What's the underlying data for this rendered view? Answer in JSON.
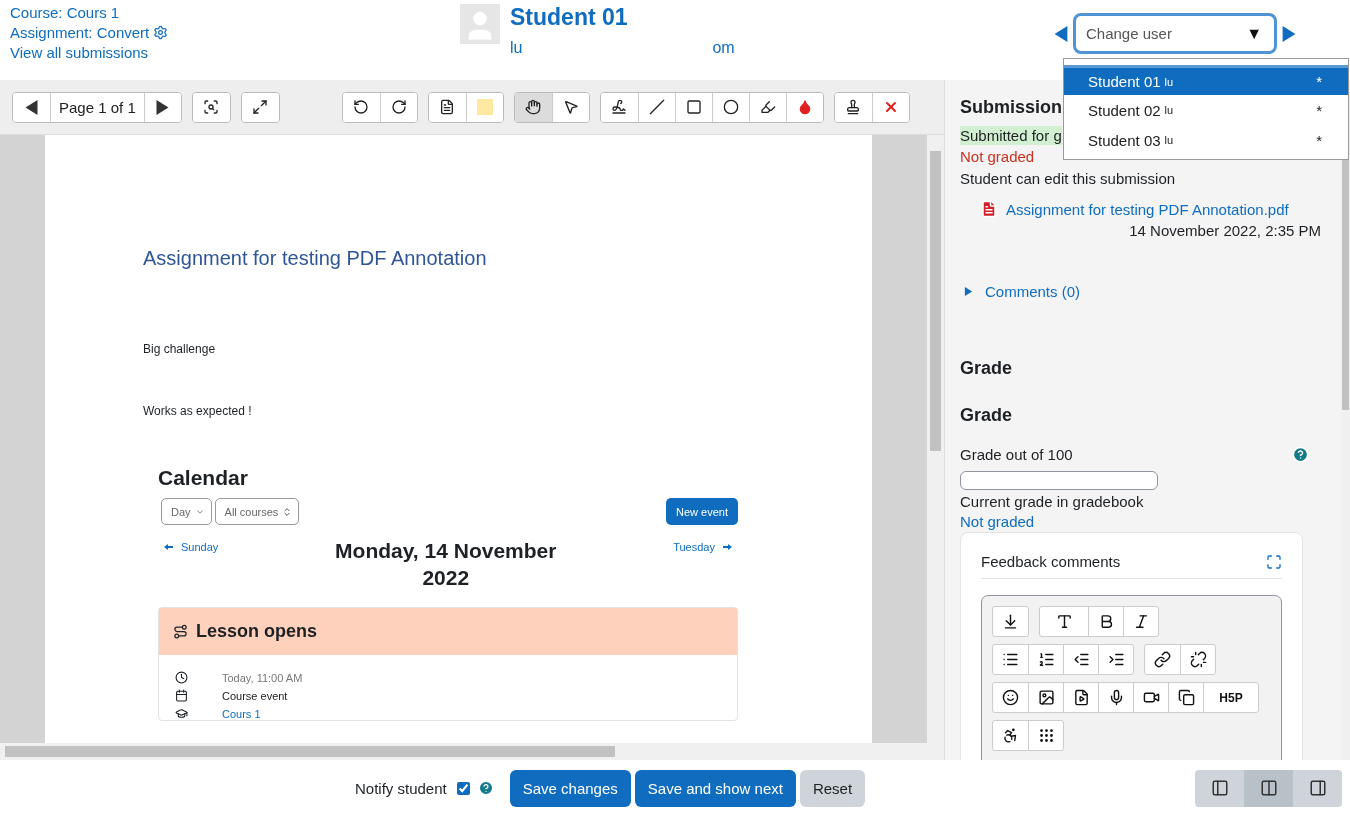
{
  "header": {
    "links": [
      "Course: Cours 1",
      "Assignment: Convert",
      "View all submissions"
    ],
    "student": {
      "name": "Student 01",
      "email_start": "lu",
      "email_end": "om"
    },
    "change_user": {
      "placeholder": "Change user",
      "caret": "▼",
      "options": [
        {
          "label": "Student 01",
          "email_start": "lu",
          "suffix": "*",
          "selected": true
        },
        {
          "label": "Student 02",
          "email_start": "lu",
          "suffix": "*",
          "selected": false
        },
        {
          "label": "Student 03",
          "email_start": "lu",
          "suffix": "*",
          "selected": false
        }
      ]
    }
  },
  "viewer": {
    "page_label": "Page 1 of 1",
    "tools": [
      {
        "kind": "hand",
        "selected": true
      },
      {
        "kind": "pointer",
        "selected": false
      },
      {
        "kind": "pen",
        "selected": false
      },
      {
        "kind": "line",
        "selected": false
      },
      {
        "kind": "rectangle",
        "selected": false
      },
      {
        "kind": "oval",
        "selected": false
      },
      {
        "kind": "highlight",
        "selected": false
      },
      {
        "kind": "color",
        "selected": false
      }
    ],
    "page": {
      "title": "Assignment for testing PDF Annotation",
      "paragraphs": [
        "Big challenge",
        "Works as expected !"
      ],
      "calendar": {
        "title": "Calendar",
        "view_select": "Day",
        "course_select": "All courses",
        "new_event": "New event",
        "prev": "Sunday",
        "next": "Tuesday",
        "date": "Monday, 14 November 2022",
        "event": {
          "title": "Lesson opens",
          "details": [
            {
              "kind": "time",
              "text": "Today, 11:00 AM"
            },
            {
              "kind": "type",
              "text": "Course event"
            },
            {
              "kind": "course",
              "text": "Cours 1"
            }
          ]
        }
      }
    }
  },
  "submission": {
    "heading": "Submission",
    "status": "Submitted for g",
    "grading_status": "Not graded",
    "edit_note": "Student can edit this submission",
    "file": "Assignment for testing PDF Annotation.pdf",
    "file_date": "14 November 2022, 2:35 PM",
    "comments": "Comments (0)"
  },
  "grade": {
    "section_heading": "Grade",
    "heading": "Grade",
    "label": "Grade out of 100",
    "gradebook_label": "Current grade in gradebook",
    "gradebook_value": "Not graded",
    "feedback": {
      "title": "Feedback comments",
      "toolbar_rows": [
        [
          [
            {
              "kind": "collapse"
            }
          ],
          [
            {
              "kind": "font"
            },
            {
              "kind": "bold"
            },
            {
              "kind": "italic"
            }
          ]
        ],
        [
          [
            {
              "kind": "bullets"
            },
            {
              "kind": "numbers"
            },
            {
              "kind": "outdent"
            },
            {
              "kind": "indent"
            }
          ],
          [
            {
              "kind": "link"
            },
            {
              "kind": "unlink"
            }
          ]
        ],
        [
          [
            {
              "kind": "emoji"
            },
            {
              "kind": "image"
            },
            {
              "kind": "media"
            },
            {
              "kind": "mic"
            },
            {
              "kind": "video"
            },
            {
              "kind": "manage"
            },
            {
              "kind": "h5p",
              "label": "H5P"
            }
          ]
        ],
        [
          [
            {
              "kind": "accessibility"
            },
            {
              "kind": "braille"
            }
          ]
        ]
      ]
    }
  },
  "footer": {
    "notify_label": "Notify student",
    "notify_checked": true,
    "buttons": [
      "Save changes",
      "Save and show next",
      "Reset"
    ],
    "layouts": [
      {
        "kind": "collapse-grader",
        "selected": false
      },
      {
        "kind": "default",
        "selected": true
      },
      {
        "kind": "collapse-review",
        "selected": false
      }
    ]
  }
}
